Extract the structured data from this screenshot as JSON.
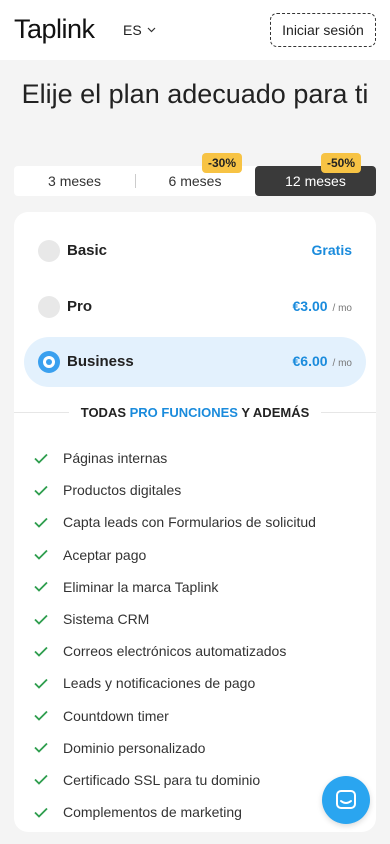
{
  "header": {
    "logo": "Taplink",
    "language": "ES",
    "login_label": "Iniciar sesión"
  },
  "page_title": "Elije el plan adecuado para ti",
  "billing_tabs": [
    {
      "label": "3 meses",
      "badge": null,
      "selected": false
    },
    {
      "label": "6 meses",
      "badge": "-30%",
      "selected": false
    },
    {
      "label": "12 meses",
      "badge": "-50%",
      "selected": true
    }
  ],
  "plans": [
    {
      "name": "Basic",
      "price": "Gratis",
      "unit": "",
      "selected": false
    },
    {
      "name": "Pro",
      "price": "€3.00",
      "unit": "/ mo",
      "selected": false
    },
    {
      "name": "Business",
      "price": "€6.00",
      "unit": "/ mo",
      "selected": true
    }
  ],
  "features_header": {
    "prefix": "TODAS ",
    "highlight": "PRO FUNCIONES",
    "suffix": " Y ADEMÁS"
  },
  "features": [
    "Páginas internas",
    "Productos digitales",
    "Capta leads con Formularios de solicitud",
    "Aceptar pago",
    "Eliminar la marca Taplink",
    "Sistema CRM",
    "Correos electrónicos automatizados",
    "Leads y notificaciones de pago",
    "Countdown timer",
    "Dominio personalizado",
    "Certificado SSL para tu dominio",
    "Complementos de marketing"
  ],
  "colors": {
    "accent": "#1a8bdc",
    "radio_active": "#3aa0ef",
    "selected_plan_bg": "#e3f1fd",
    "badge": "#f7c344",
    "check": "#2e9e4e",
    "active_tab": "#3a3a3a"
  },
  "icons": {
    "language_dropdown": "chevron-down-icon",
    "feature_check": "check-icon",
    "chat": "chat-bubble-icon"
  }
}
